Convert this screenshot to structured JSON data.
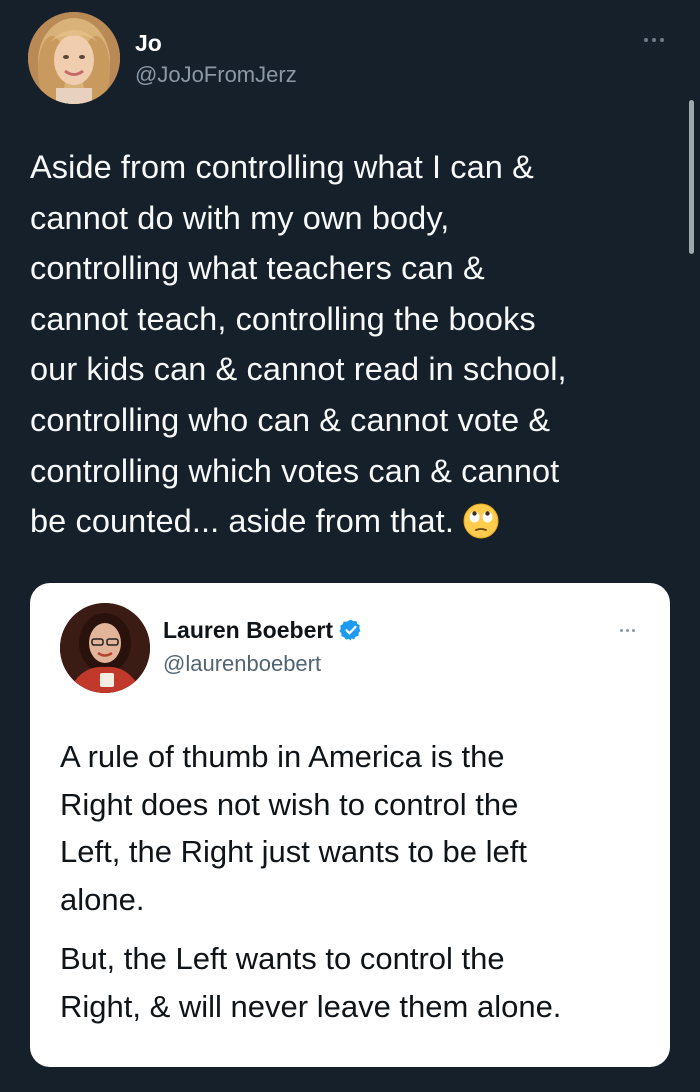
{
  "tweet": {
    "author": {
      "name": "Jo",
      "handle": "@JoJoFromJerz"
    },
    "text_lines": [
      "Aside from controlling what I can &",
      "cannot do with my own body,",
      "controlling what teachers can &",
      "cannot teach, controlling the books",
      "our kids can & cannot read in school,",
      "controlling who can & cannot vote &",
      "controlling which votes can & cannot",
      "be counted... aside from that."
    ],
    "emoji": "face-with-rolling-eyes-icon",
    "more_icon": "more-horizontal-icon"
  },
  "quote": {
    "author": {
      "name": "Lauren Boebert",
      "handle": "@laurenboebert",
      "verified": true
    },
    "paragraph1_lines": [
      "A rule of thumb in America is the",
      "Right does not wish to control the",
      "Left, the Right just wants to be left",
      "alone."
    ],
    "paragraph2_lines": [
      "But, the Left wants to control the",
      "Right, & will never leave them alone."
    ]
  },
  "colors": {
    "background": "#15202b",
    "text": "#f7f9f9",
    "secondary_text": "#8b98a5",
    "verified": "#1d9bf0",
    "card_bg": "#ffffff"
  }
}
